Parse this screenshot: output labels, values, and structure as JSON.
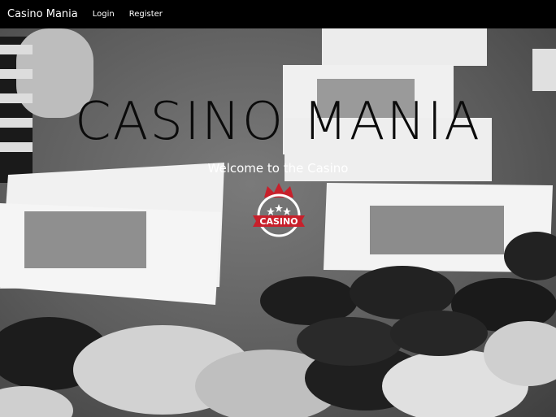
{
  "navbar": {
    "brand": "Casino Mania",
    "links": [
      "Login",
      "Register"
    ]
  },
  "hero": {
    "title": "CASINO MANIA",
    "subtitle": "Welcome to the Casino",
    "logo_text": "CASINO"
  },
  "colors": {
    "navbar_bg": "#000000",
    "logo_red": "#c8202b"
  }
}
